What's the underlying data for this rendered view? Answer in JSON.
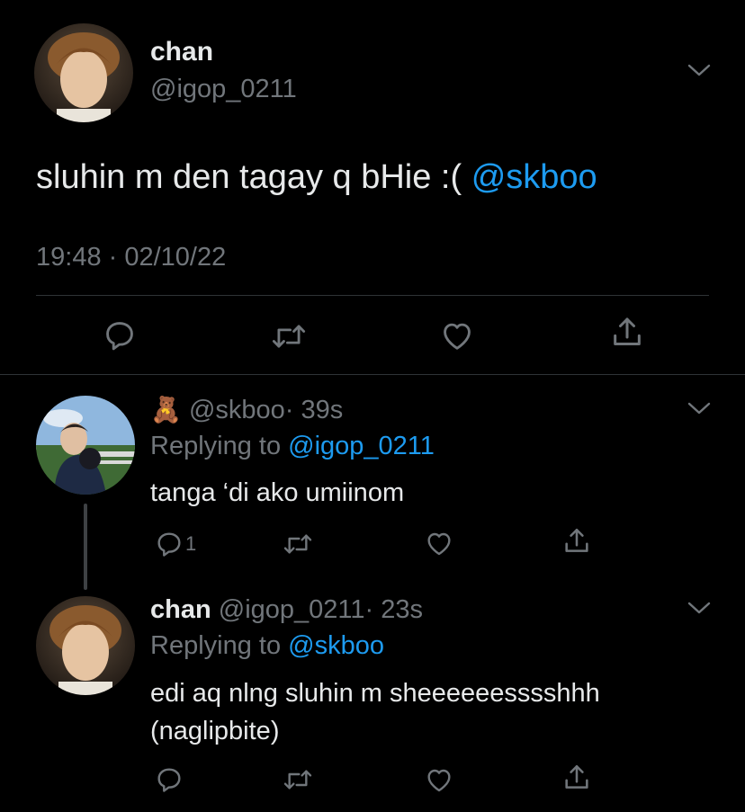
{
  "main_tweet": {
    "display_name": "chan",
    "handle": "@igop_0211",
    "text": "sluhin m den tagay q bHie :(",
    "mention": "@skboo",
    "timestamp": "19:48 · 02/10/22"
  },
  "reply1": {
    "emoji": "🧸",
    "handle": "@skboo",
    "time": "· 39s",
    "replying_prefix": "Replying to",
    "replying_to": "@igop_0211",
    "text": "tanga ‘di ako umiinom",
    "reply_count": "1"
  },
  "reply2": {
    "display_name": "chan",
    "handle": "@igop_0211",
    "time": "· 23s",
    "replying_prefix": "Replying to",
    "replying_to": "@skboo",
    "text_line1": "edi aq nlng sluhin m sheeeeeesssshhh",
    "text_line2": "(naglipbite)"
  },
  "colors": {
    "background": "#000000",
    "text": "#e7e9ea",
    "muted": "#71767b",
    "accent": "#1d9bf0",
    "divider": "#2f3336"
  },
  "icons": [
    "chevron-down-icon",
    "reply-icon",
    "retweet-icon",
    "like-icon",
    "share-icon"
  ]
}
